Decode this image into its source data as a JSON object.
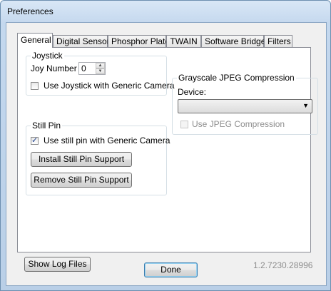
{
  "window": {
    "title": "Preferences"
  },
  "tabs": [
    {
      "label": "General",
      "active": true
    },
    {
      "label": "Digital Sensor",
      "active": false
    },
    {
      "label": "Phosphor Plate",
      "active": false
    },
    {
      "label": "TWAIN",
      "active": false
    },
    {
      "label": "Software Bridge",
      "active": false
    },
    {
      "label": "Filters",
      "active": false
    }
  ],
  "joystick": {
    "title": "Joystick",
    "joy_number_label": "Joy Number",
    "joy_number_value": "0",
    "use_generic_label": "Use Joystick with Generic Camera",
    "use_generic_checked": false
  },
  "still_pin": {
    "title": "Still Pin",
    "use_generic_label": "Use still pin with Generic Camera",
    "use_generic_checked": true,
    "install_label": "Install Still Pin Support",
    "remove_label": "Remove Still Pin Support"
  },
  "jpeg": {
    "title": "Grayscale JPEG Compression",
    "device_label": "Device:",
    "device_value": "",
    "use_jpeg_label": "Use JPEG Compression",
    "use_jpeg_checked": false
  },
  "footer": {
    "show_log_label": "Show Log Files",
    "version": "1.2.7230.28996",
    "done_label": "Done"
  }
}
